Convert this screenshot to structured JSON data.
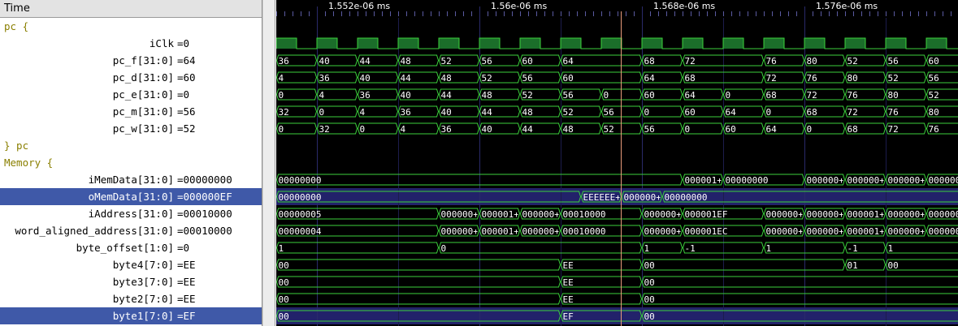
{
  "names_panel": {
    "time_header": "Time",
    "rows": [
      {
        "kind": "group",
        "text": "pc {"
      },
      {
        "kind": "sig",
        "name": "iClk",
        "value": "=0"
      },
      {
        "kind": "sig",
        "name": "pc_f[31:0]",
        "value": "=64"
      },
      {
        "kind": "sig",
        "name": "pc_d[31:0]",
        "value": "=60"
      },
      {
        "kind": "sig",
        "name": "pc_e[31:0]",
        "value": "=0"
      },
      {
        "kind": "sig",
        "name": "pc_m[31:0]",
        "value": "=56"
      },
      {
        "kind": "sig",
        "name": "pc_w[31:0]",
        "value": "=52"
      },
      {
        "kind": "group",
        "text": "} pc"
      },
      {
        "kind": "group",
        "text": "Memory {"
      },
      {
        "kind": "sig",
        "name": "iMemData[31:0]",
        "value": "=00000000"
      },
      {
        "kind": "sig",
        "name": "oMemData[31:0]",
        "value": "=000000EF",
        "selected": true
      },
      {
        "kind": "sig",
        "name": "iAddress[31:0]",
        "value": "=00010000"
      },
      {
        "kind": "sig",
        "name": "word_aligned_address[31:0]",
        "value": "=00010000"
      },
      {
        "kind": "sig",
        "name": "byte_offset[1:0]",
        "value": "=0"
      },
      {
        "kind": "sig",
        "name": "byte4[7:0]",
        "value": "=EE"
      },
      {
        "kind": "sig",
        "name": "byte3[7:0]",
        "value": "=EE"
      },
      {
        "kind": "sig",
        "name": "byte2[7:0]",
        "value": "=EE"
      },
      {
        "kind": "sig",
        "name": "byte1[7:0]",
        "value": "=EF",
        "selected": true
      }
    ]
  },
  "timeline": {
    "major_ticks": [
      {
        "label": "1.552e-06 ms",
        "x": 0
      },
      {
        "label": "1.56e-06 ms",
        "x": 1
      },
      {
        "label": "1.568e-06 ms",
        "x": 2
      },
      {
        "label": "1.576e-06 ms",
        "x": 3
      }
    ],
    "cursor_slot": 8.5
  },
  "waves": [
    {
      "row": 1,
      "type": "clock"
    },
    {
      "row": 2,
      "type": "bus",
      "segments": [
        [
          0,
          1,
          "36"
        ],
        [
          1,
          2,
          "40"
        ],
        [
          2,
          3,
          "44"
        ],
        [
          3,
          4,
          "48"
        ],
        [
          4,
          5,
          "52"
        ],
        [
          5,
          6,
          "56"
        ],
        [
          6,
          7,
          "60"
        ],
        [
          7,
          9,
          "64"
        ],
        [
          9,
          10,
          "68"
        ],
        [
          10,
          12,
          "72"
        ],
        [
          12,
          13,
          "76"
        ],
        [
          13,
          14,
          "80"
        ],
        [
          14,
          15,
          "52"
        ],
        [
          15,
          16,
          "56"
        ],
        [
          16,
          17,
          "60"
        ]
      ]
    },
    {
      "row": 3,
      "type": "bus",
      "segments": [
        [
          0,
          1,
          "4"
        ],
        [
          1,
          2,
          "36"
        ],
        [
          2,
          3,
          "40"
        ],
        [
          3,
          4,
          "44"
        ],
        [
          4,
          5,
          "48"
        ],
        [
          5,
          6,
          "52"
        ],
        [
          6,
          7,
          "56"
        ],
        [
          7,
          9,
          "60"
        ],
        [
          9,
          10,
          "64"
        ],
        [
          10,
          12,
          "68"
        ],
        [
          12,
          13,
          "72"
        ],
        [
          13,
          14,
          "76"
        ],
        [
          14,
          15,
          "80"
        ],
        [
          15,
          16,
          "52"
        ],
        [
          16,
          17,
          "56"
        ]
      ]
    },
    {
      "row": 4,
      "type": "bus",
      "segments": [
        [
          0,
          1,
          "0"
        ],
        [
          1,
          2,
          "4"
        ],
        [
          2,
          3,
          "36"
        ],
        [
          3,
          4,
          "40"
        ],
        [
          4,
          5,
          "44"
        ],
        [
          5,
          6,
          "48"
        ],
        [
          6,
          7,
          "52"
        ],
        [
          7,
          8,
          "56"
        ],
        [
          8,
          9,
          "0"
        ],
        [
          9,
          10,
          "60"
        ],
        [
          10,
          11,
          "64"
        ],
        [
          11,
          12,
          "0"
        ],
        [
          12,
          13,
          "68"
        ],
        [
          13,
          14,
          "72"
        ],
        [
          14,
          15,
          "76"
        ],
        [
          15,
          16,
          "80"
        ],
        [
          16,
          17,
          "52"
        ]
      ]
    },
    {
      "row": 5,
      "type": "bus",
      "segments": [
        [
          0,
          1,
          "32"
        ],
        [
          1,
          2,
          "0"
        ],
        [
          2,
          3,
          "4"
        ],
        [
          3,
          4,
          "36"
        ],
        [
          4,
          5,
          "40"
        ],
        [
          5,
          6,
          "44"
        ],
        [
          6,
          7,
          "48"
        ],
        [
          7,
          8,
          "52"
        ],
        [
          8,
          9,
          "56"
        ],
        [
          9,
          10,
          "0"
        ],
        [
          10,
          11,
          "60"
        ],
        [
          11,
          12,
          "64"
        ],
        [
          12,
          13,
          "0"
        ],
        [
          13,
          14,
          "68"
        ],
        [
          14,
          15,
          "72"
        ],
        [
          15,
          16,
          "76"
        ],
        [
          16,
          17,
          "80"
        ]
      ]
    },
    {
      "row": 6,
      "type": "bus",
      "segments": [
        [
          0,
          1,
          "0"
        ],
        [
          1,
          2,
          "32"
        ],
        [
          2,
          3,
          "0"
        ],
        [
          3,
          4,
          "4"
        ],
        [
          4,
          5,
          "36"
        ],
        [
          5,
          6,
          "40"
        ],
        [
          6,
          7,
          "44"
        ],
        [
          7,
          8,
          "48"
        ],
        [
          8,
          9,
          "52"
        ],
        [
          9,
          10,
          "56"
        ],
        [
          10,
          11,
          "0"
        ],
        [
          11,
          12,
          "60"
        ],
        [
          12,
          13,
          "64"
        ],
        [
          13,
          14,
          "0"
        ],
        [
          14,
          15,
          "68"
        ],
        [
          15,
          16,
          "72"
        ],
        [
          16,
          17,
          "76"
        ]
      ]
    },
    {
      "row": 9,
      "type": "bus",
      "segments": [
        [
          0,
          10,
          "00000000"
        ],
        [
          10,
          11,
          "000001+"
        ],
        [
          11,
          13,
          "00000000"
        ],
        [
          13,
          14,
          "000000+"
        ],
        [
          14,
          15,
          "000000+"
        ],
        [
          15,
          16,
          "000000+"
        ],
        [
          16,
          17,
          "0000000"
        ]
      ]
    },
    {
      "row": 10,
      "type": "bus",
      "segments": [
        [
          0,
          7.5,
          "00000000"
        ],
        [
          7.5,
          8.5,
          "EEEEEE+"
        ],
        [
          8.5,
          9.5,
          "000000+"
        ],
        [
          9.5,
          17,
          "00000000"
        ]
      ]
    },
    {
      "row": 11,
      "type": "bus",
      "segments": [
        [
          0,
          4,
          "00000005"
        ],
        [
          4,
          5,
          "000000+"
        ],
        [
          5,
          6,
          "000001+"
        ],
        [
          6,
          7,
          "000000+"
        ],
        [
          7,
          9,
          "00010000"
        ],
        [
          9,
          10,
          "000000+"
        ],
        [
          10,
          12,
          "000001EF"
        ],
        [
          12,
          13,
          "000000+"
        ],
        [
          13,
          14,
          "000000+"
        ],
        [
          14,
          15,
          "000001+"
        ],
        [
          15,
          16,
          "000000+"
        ],
        [
          16,
          17,
          "0000000"
        ]
      ]
    },
    {
      "row": 12,
      "type": "bus",
      "segments": [
        [
          0,
          4,
          "00000004"
        ],
        [
          4,
          5,
          "000000+"
        ],
        [
          5,
          6,
          "000001+"
        ],
        [
          6,
          7,
          "000000+"
        ],
        [
          7,
          9,
          "00010000"
        ],
        [
          9,
          10,
          "000000+"
        ],
        [
          10,
          12,
          "000001EC"
        ],
        [
          12,
          13,
          "000000+"
        ],
        [
          13,
          14,
          "000000+"
        ],
        [
          14,
          15,
          "000001+"
        ],
        [
          15,
          16,
          "000000+"
        ],
        [
          16,
          17,
          "0000000"
        ]
      ]
    },
    {
      "row": 13,
      "type": "bus",
      "segments": [
        [
          0,
          4,
          "1"
        ],
        [
          4,
          9,
          "0"
        ],
        [
          9,
          10,
          "1"
        ],
        [
          10,
          12,
          "-1"
        ],
        [
          12,
          14,
          "1"
        ],
        [
          14,
          15,
          "-1"
        ],
        [
          15,
          17,
          "1"
        ]
      ]
    },
    {
      "row": 14,
      "type": "bus",
      "segments": [
        [
          0,
          7,
          "00"
        ],
        [
          7,
          9,
          "EE"
        ],
        [
          9,
          14,
          "00"
        ],
        [
          14,
          15,
          "01"
        ],
        [
          15,
          17,
          "00"
        ]
      ]
    },
    {
      "row": 15,
      "type": "bus",
      "segments": [
        [
          0,
          7,
          "00"
        ],
        [
          7,
          9,
          "EE"
        ],
        [
          9,
          17,
          "00"
        ]
      ]
    },
    {
      "row": 16,
      "type": "bus",
      "segments": [
        [
          0,
          7,
          "00"
        ],
        [
          7,
          9,
          "EE"
        ],
        [
          9,
          17,
          "00"
        ]
      ]
    },
    {
      "row": 17,
      "type": "bus",
      "segments": [
        [
          0,
          7,
          "00"
        ],
        [
          7,
          9,
          "EF"
        ],
        [
          9,
          17,
          "00"
        ]
      ]
    }
  ],
  "colors": {
    "wave_bg": "#000000",
    "wave_line": "#3cd13c",
    "clock_fill": "#1b6e2a",
    "text_on_wave": "#ffffff",
    "grid": "#2a2a6a",
    "selected_row": "#22226a",
    "cursor": "#e89a7a",
    "group_text": "#8a7f00"
  }
}
